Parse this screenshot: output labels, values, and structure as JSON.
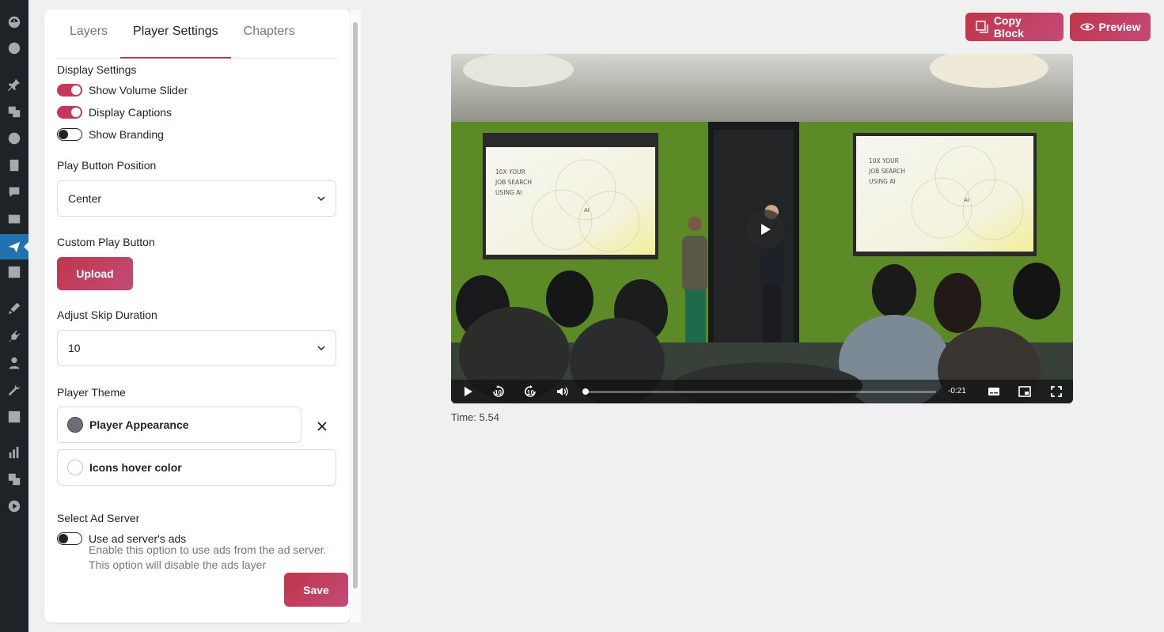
{
  "tabs": [
    "Layers",
    "Player Settings",
    "Chapters"
  ],
  "display_settings": {
    "heading": "Display Settings",
    "toggles": [
      {
        "label": "Show Volume Slider",
        "on": true
      },
      {
        "label": "Display Captions",
        "on": true
      },
      {
        "label": "Show Branding",
        "on": false
      }
    ]
  },
  "play_button_position": {
    "label": "Play Button Position",
    "value": "Center"
  },
  "custom_play_button": {
    "label": "Custom Play Button",
    "button": "Upload"
  },
  "skip_duration": {
    "label": "Adjust Skip Duration",
    "value": "10"
  },
  "player_theme": {
    "label": "Player Theme",
    "appearance": {
      "label": "Player Appearance",
      "color": "#6b6e75"
    },
    "hover": {
      "label": "Icons hover color",
      "color": "#ffffff"
    }
  },
  "ad_server": {
    "label": "Select Ad Server",
    "toggle_label": "Use ad server's ads",
    "on": false,
    "help": "Enable this option to use ads from the ad server. This option will disable the ads layer"
  },
  "save_label": "Save",
  "top_buttons": {
    "copy": "Copy Block",
    "preview": "Preview"
  },
  "video": {
    "remaining": "-0:21",
    "skip_value": "10",
    "slide_title": "10X YOUR JOB SEARCH USING AI",
    "time_readout": "Time: 5.54"
  },
  "colors": {
    "accent": "#c7375a",
    "wp_dark": "#1d2327",
    "wp_active": "#2271b1"
  }
}
